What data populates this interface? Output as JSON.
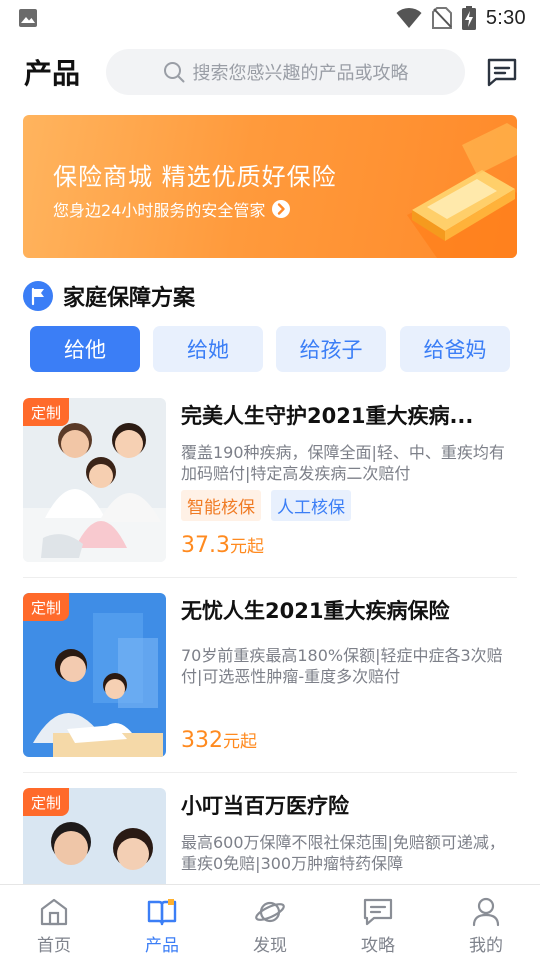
{
  "status_bar": {
    "time": "5:30"
  },
  "header": {
    "title": "产品",
    "search_placeholder": "搜索您感兴趣的产品或攻略"
  },
  "banner": {
    "title": "保险商城 精选优质好保险",
    "subtitle": "您身边24小时服务的安全管家"
  },
  "section": {
    "title": "家庭保障方案"
  },
  "tabs": [
    {
      "label": "给他",
      "active": true
    },
    {
      "label": "给她",
      "active": false
    },
    {
      "label": "给孩子",
      "active": false
    },
    {
      "label": "给爸妈",
      "active": false
    }
  ],
  "products": [
    {
      "badge": "定制",
      "title": "完美人生守护2021重大疾病...",
      "description": "覆盖190种疾病，保障全面|轻、中、重疾均有加码赔付|特定高发疾病二次赔付",
      "tags": [
        "智能核保",
        "人工核保"
      ],
      "price": "37.3",
      "price_unit": "元起"
    },
    {
      "badge": "定制",
      "title": "无忧人生2021重大疾病保险",
      "description": "70岁前重疾最高180%保额|轻症中症各3次赔付|可选恶性肿瘤-重度多次赔付",
      "tags": [],
      "price": "332",
      "price_unit": "元起"
    },
    {
      "badge": "定制",
      "title": "小叮当百万医疗险",
      "description": "最高600万保障不限社保范围|免赔额可递减，重疾0免赔|300万肿瘤特药保障",
      "tags": [],
      "price": "",
      "price_unit": ""
    }
  ],
  "bottom_nav": [
    {
      "label": "首页",
      "icon": "home-icon",
      "active": false
    },
    {
      "label": "产品",
      "icon": "book-icon",
      "active": true
    },
    {
      "label": "发现",
      "icon": "planet-icon",
      "active": false
    },
    {
      "label": "攻略",
      "icon": "chat-icon",
      "active": false
    },
    {
      "label": "我的",
      "icon": "person-icon",
      "active": false
    }
  ],
  "colors": {
    "accent": "#3b7ef6",
    "price": "#ff8a1f",
    "badge": "#ff6a2a",
    "banner": "#ff9a3c"
  }
}
